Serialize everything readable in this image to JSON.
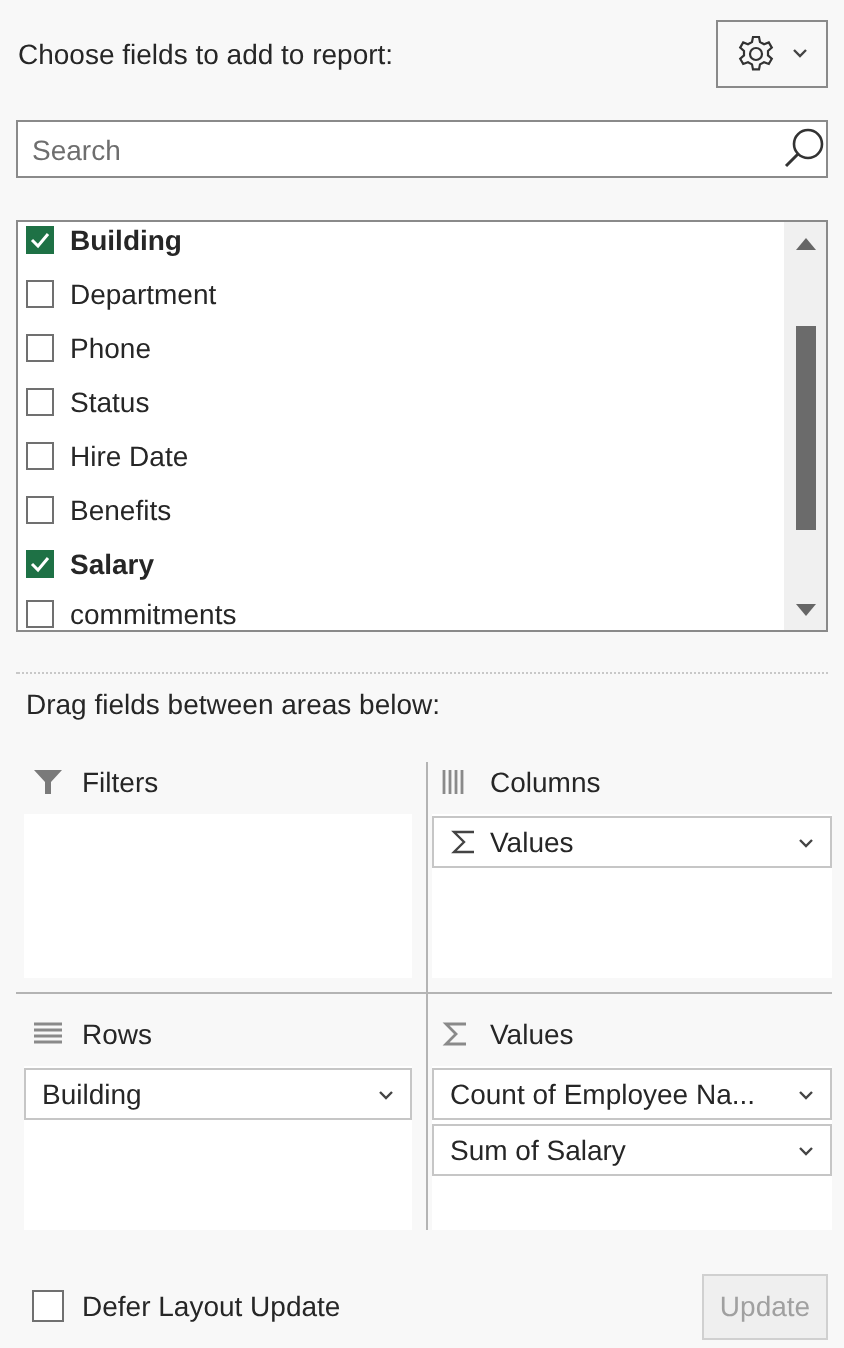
{
  "header": {
    "title": "Choose fields to add to report:"
  },
  "search": {
    "placeholder": "Search"
  },
  "fields": [
    {
      "label": "Building",
      "checked": true
    },
    {
      "label": "Department",
      "checked": false
    },
    {
      "label": "Phone",
      "checked": false
    },
    {
      "label": "Status",
      "checked": false
    },
    {
      "label": "Hire Date",
      "checked": false
    },
    {
      "label": "Benefits",
      "checked": false
    },
    {
      "label": "Salary",
      "checked": true
    },
    {
      "label": "commitments",
      "checked": false
    }
  ],
  "instructions": "Drag fields between areas below:",
  "areas": [
    {
      "kind": "filters",
      "title": "Filters"
    },
    {
      "kind": "columns",
      "title": "Columns",
      "items": [
        {
          "kind": "values",
          "label": "Values"
        }
      ]
    },
    {
      "kind": "rows",
      "title": "Rows",
      "items": [
        {
          "kind": "field",
          "label": "Building"
        }
      ]
    },
    {
      "kind": "values",
      "title": "Values",
      "items": [
        {
          "kind": "field",
          "label": "Count of Employee Na..."
        },
        {
          "kind": "field",
          "label": "Sum of Salary"
        }
      ]
    }
  ],
  "footer": {
    "defer": {
      "label": "Defer Layout Update",
      "checked": false
    },
    "update": {
      "label": "Update",
      "disabled": true
    }
  }
}
